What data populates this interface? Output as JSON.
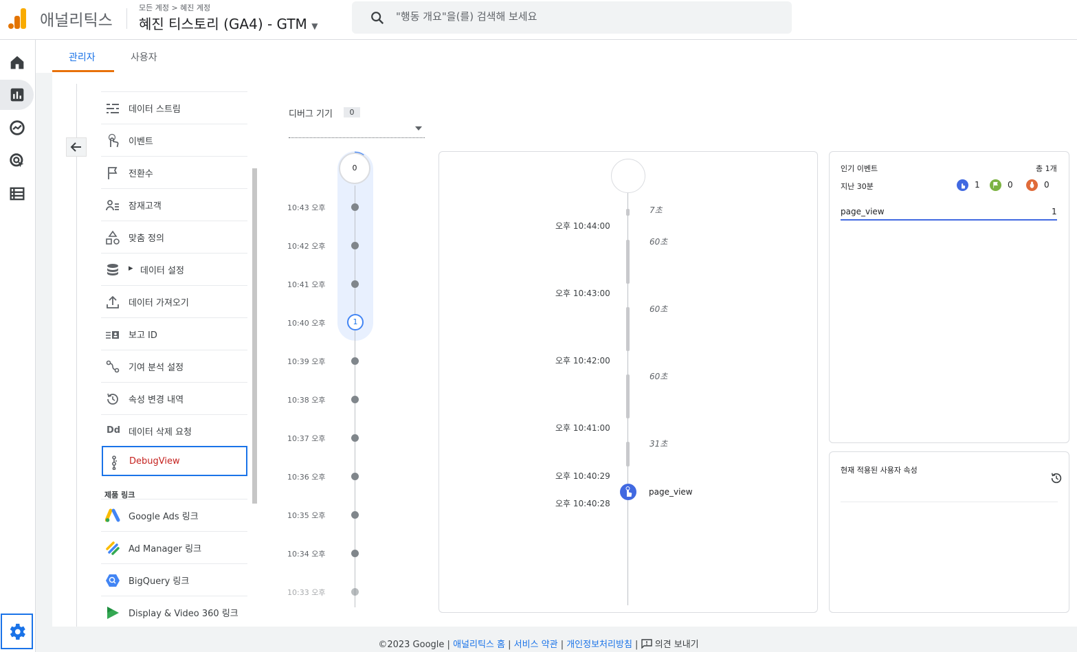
{
  "header": {
    "app_name": "애널리틱스",
    "breadcrumb": "모든 계정 > 혜진 계정",
    "property": "혜진 티스토리 (GA4) - GTM",
    "search_placeholder": "\"행동 개요\"을(를) 검색해 보세요"
  },
  "rail": {
    "icons": [
      "home-icon",
      "reports-icon",
      "explore-icon",
      "advertising-icon",
      "configure-icon",
      "settings-icon"
    ]
  },
  "tabs": {
    "admin": "관리자",
    "users": "사용자"
  },
  "nav": {
    "items": [
      {
        "label": "데이터 스트림",
        "icon": "data-stream-icon"
      },
      {
        "label": "이벤트",
        "icon": "touch-icon"
      },
      {
        "label": "전환수",
        "icon": "flag-icon"
      },
      {
        "label": "잠재고객",
        "icon": "audience-icon"
      },
      {
        "label": "맞춤 정의",
        "icon": "shapes-icon"
      },
      {
        "label": "데이터 설정",
        "icon": "database-icon"
      },
      {
        "label": "데이터 가져오기",
        "icon": "upload-icon"
      },
      {
        "label": "보고 ID",
        "icon": "reporting-id-icon"
      },
      {
        "label": "기여 분석 설정",
        "icon": "attribution-icon"
      },
      {
        "label": "속성 변경 내역",
        "icon": "history-icon"
      },
      {
        "label": "데이터 삭제 요청",
        "icon": "data-deletion-icon"
      },
      {
        "label": "DebugView",
        "icon": "debug-icon"
      }
    ],
    "section_label": "제품 링크",
    "links": [
      {
        "label": "Google Ads 링크",
        "icon": "google-ads-icon"
      },
      {
        "label": "Ad Manager 링크",
        "icon": "ad-manager-icon"
      },
      {
        "label": "BigQuery 링크",
        "icon": "bigquery-icon"
      },
      {
        "label": "Display & Video 360 링크",
        "icon": "dv360-icon"
      }
    ]
  },
  "debug": {
    "device_label": "디버그 기기",
    "device_count": "0",
    "minutes_top": "0",
    "minutes": [
      {
        "time": "10:43 오후"
      },
      {
        "time": "10:42 오후"
      },
      {
        "time": "10:41 오후"
      },
      {
        "time": "10:40 오후",
        "count": "1"
      },
      {
        "time": "10:39 오후"
      },
      {
        "time": "10:38 오후"
      },
      {
        "time": "10:37 오후"
      },
      {
        "time": "10:36 오후"
      },
      {
        "time": "10:35 오후"
      },
      {
        "time": "10:34 오후"
      },
      {
        "time": "10:33 오후"
      }
    ],
    "seconds": {
      "gaps": [
        "7초",
        "60초",
        "60초",
        "60초",
        "31초"
      ],
      "times": [
        "오후 10:44:00",
        "오후 10:43:00",
        "오후 10:42:00",
        "오후 10:41:00",
        "오후 10:40:29",
        "오후 10:40:28"
      ],
      "event": "page_view"
    }
  },
  "top_events": {
    "title": "인기 이벤트",
    "total": "총 1개",
    "range": "지난 30분",
    "counts": [
      {
        "value": "1",
        "icon": "event-icon",
        "color": "#4169e1"
      },
      {
        "value": "0",
        "icon": "conversion-icon",
        "color": "#7cb342"
      },
      {
        "value": "0",
        "icon": "error-icon",
        "color": "#e06b3a"
      }
    ],
    "rows": [
      {
        "name": "page_view",
        "count": "1"
      }
    ]
  },
  "user_props": {
    "title": "현재 적용된 사용자 속성"
  },
  "footer": {
    "copyright": "©2023 Google",
    "home": "애널리틱스 홈",
    "terms": "서비스 약관",
    "privacy": "개인정보처리방침",
    "feedback": "의견 보내기"
  }
}
